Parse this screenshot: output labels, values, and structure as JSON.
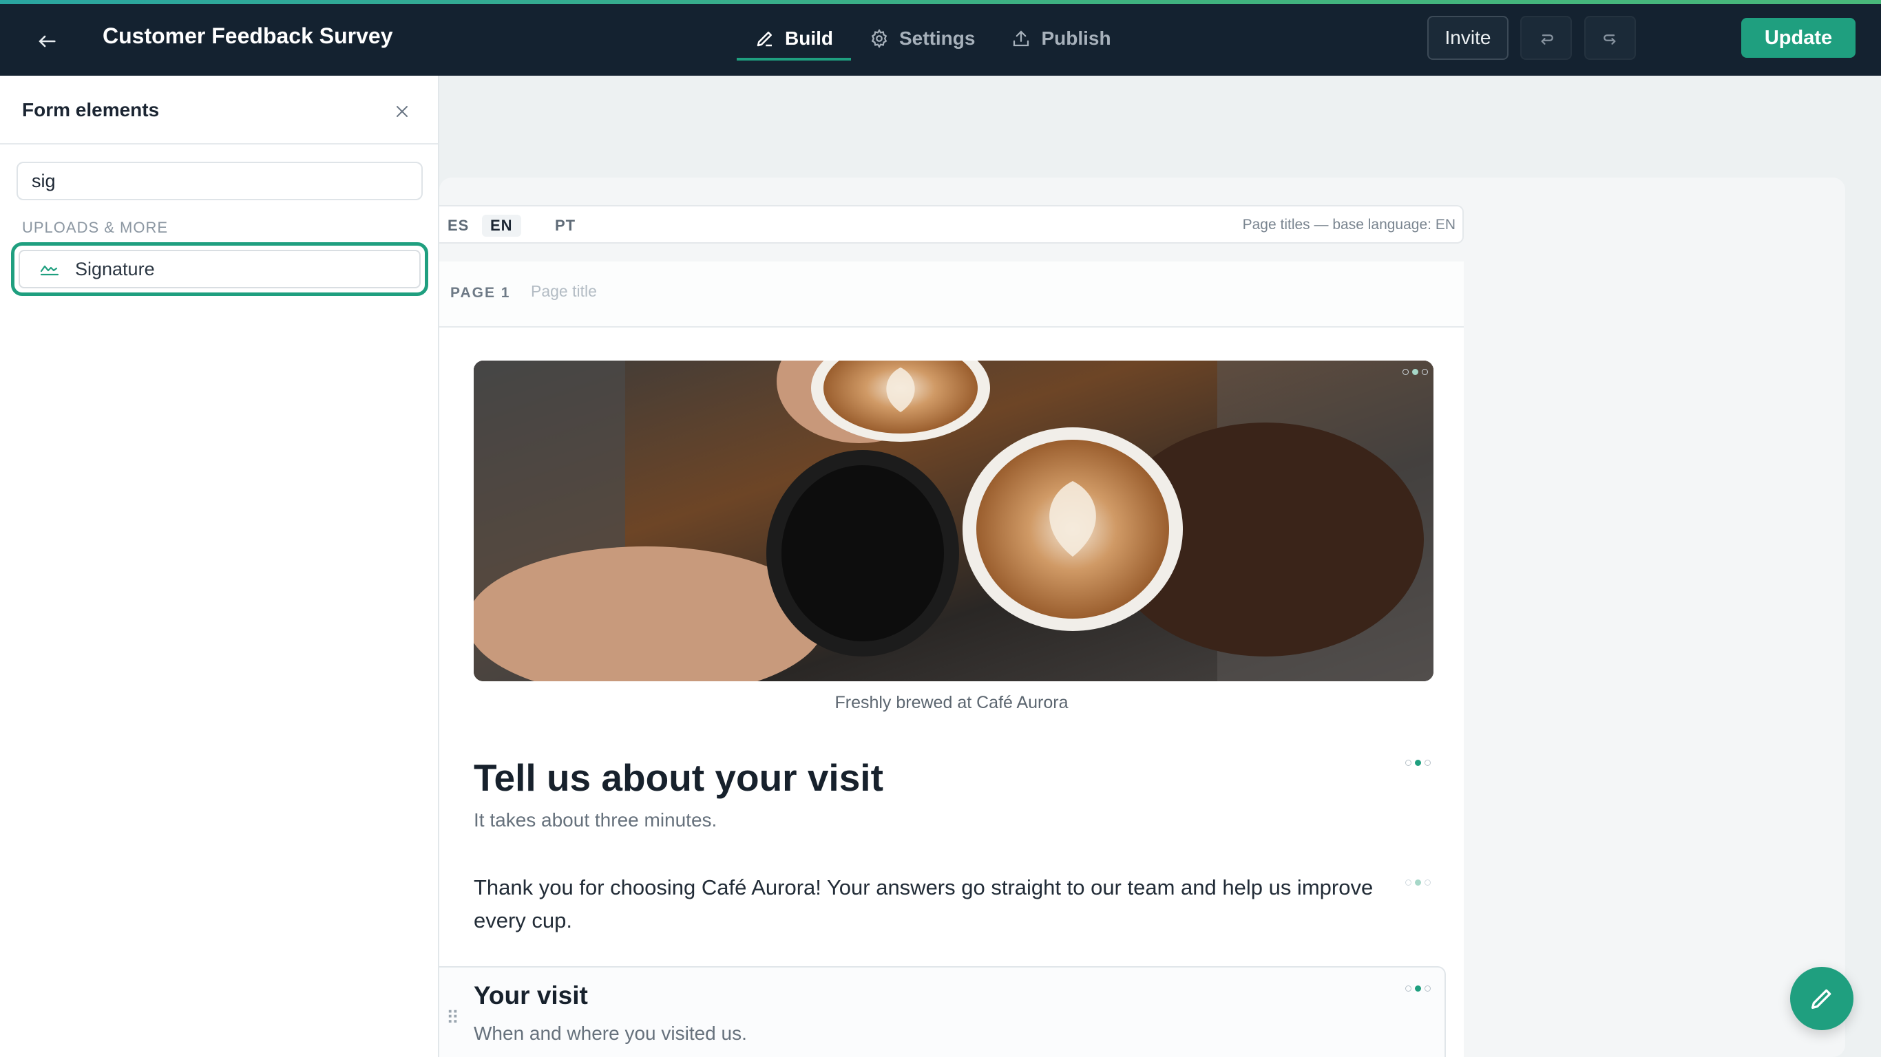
{
  "header": {
    "title": "Customer Feedback Survey",
    "tabs": [
      {
        "label": "Build",
        "icon": "pencil-icon",
        "active": true
      },
      {
        "label": "Settings",
        "icon": "gear-icon",
        "active": false
      },
      {
        "label": "Publish",
        "icon": "upload-icon",
        "active": false
      }
    ],
    "invite_label": "Invite",
    "update_label": "Update",
    "accent_color": "#1f9f7f"
  },
  "panel": {
    "title": "Form elements",
    "search": {
      "value": "sig"
    },
    "group_label": "UPLOADS & MORE",
    "items": [
      {
        "label": "Signature",
        "icon": "signature-icon",
        "highlighted": true
      }
    ]
  },
  "languages": {
    "items": [
      "ES",
      "EN",
      "PT"
    ],
    "active": "EN",
    "note": "Page titles — base language: EN"
  },
  "page": {
    "number_label": "PAGE 1",
    "title_placeholder": "Page title",
    "image_caption": "Freshly brewed at Café Aurora",
    "heading": "Tell us about your visit",
    "subheading": "It takes about three minutes.",
    "paragraph": "Thank you for choosing Café Aurora! Your answers go straight to our team and help us improve every cup.",
    "section": {
      "title": "Your visit",
      "subtitle": "When and where you visited us."
    }
  }
}
